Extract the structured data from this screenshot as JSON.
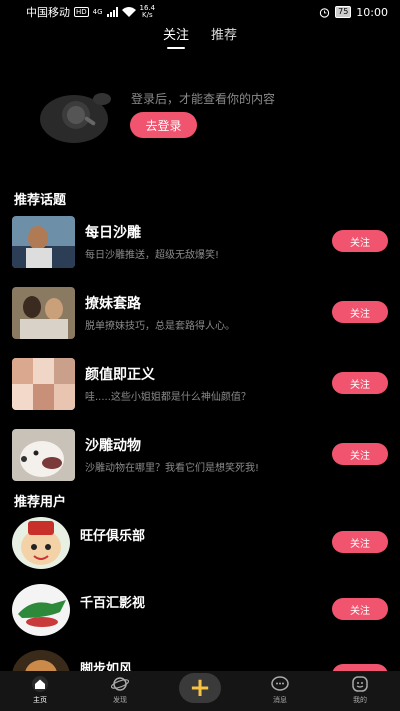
{
  "status_bar": {
    "carrier": "中国移动",
    "hd_badge": "HD",
    "net_type": "4G",
    "speed_value": "16.4",
    "speed_unit": "K/s",
    "battery": "75",
    "time": "10:00"
  },
  "top_tabs": [
    {
      "label": "关注",
      "active": true
    },
    {
      "label": "推荐",
      "active": false
    }
  ],
  "login_prompt": {
    "text": "登录后，才能查看你的内容",
    "button_label": "去登录"
  },
  "topics_section": {
    "title": "推荐话题",
    "items": [
      {
        "title": "每日沙雕",
        "desc": "每日沙雕推送，超级无敌爆笑!",
        "button": "关注"
      },
      {
        "title": "撩妹套路",
        "desc": "脱单撩妹技巧，总是套路得人心。",
        "button": "关注"
      },
      {
        "title": "颜值即正义",
        "desc": "哇.....这些小姐姐都是什么神仙颜值？",
        "button": "关注"
      },
      {
        "title": "沙雕动物",
        "desc": "沙雕动物在哪里？我看它们是想笑死我!",
        "button": "关注"
      }
    ]
  },
  "users_section": {
    "title": "推荐用户",
    "items": [
      {
        "name": "旺仔俱乐部",
        "button": "关注"
      },
      {
        "name": "千百汇影视",
        "button": "关注"
      },
      {
        "name": "脚步如风",
        "button": "关注"
      }
    ]
  },
  "bottom_nav": [
    {
      "label": "主页",
      "icon": "home-icon",
      "active": true
    },
    {
      "label": "发现",
      "icon": "planet-icon",
      "active": false
    },
    {
      "label": "",
      "icon": "plus-icon",
      "active": false
    },
    {
      "label": "消息",
      "icon": "chat-icon",
      "active": false
    },
    {
      "label": "我的",
      "icon": "profile-icon",
      "active": false
    }
  ],
  "colors": {
    "accent": "#f0546e",
    "background": "#000000",
    "muted_text": "#8a8a8a"
  }
}
